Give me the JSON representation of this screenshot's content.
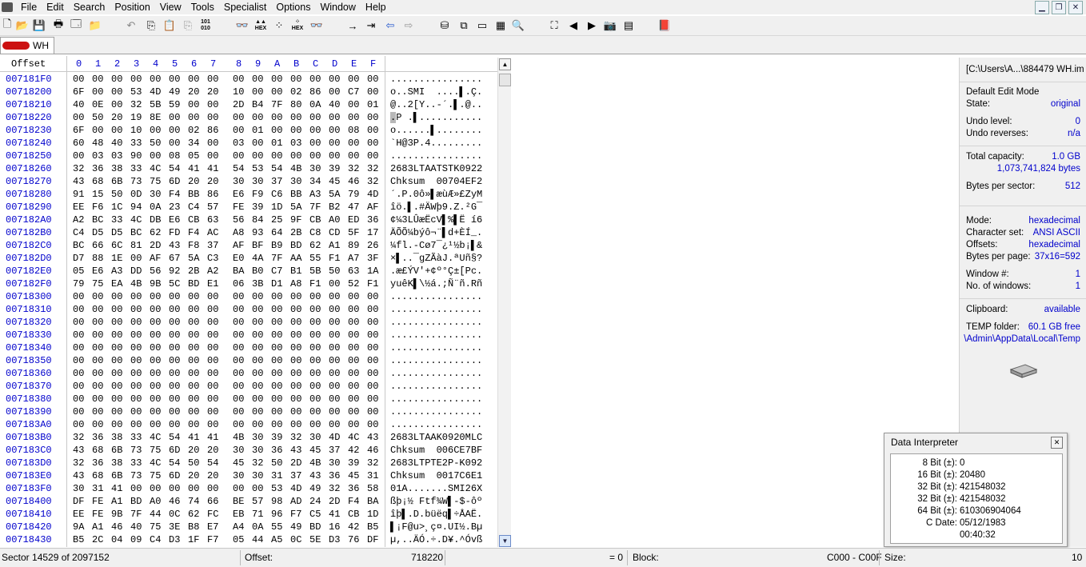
{
  "menu": [
    "File",
    "Edit",
    "Search",
    "Position",
    "View",
    "Tools",
    "Specialist",
    "Options",
    "Window",
    "Help"
  ],
  "tab": {
    "label": "WH"
  },
  "header": {
    "offset_label": "Offset",
    "cols": [
      "0",
      "1",
      "2",
      "3",
      "4",
      "5",
      "6",
      "7",
      "8",
      "9",
      "A",
      "B",
      "C",
      "D",
      "E",
      "F"
    ]
  },
  "rows": [
    {
      "offset": "007181F0",
      "bytes": [
        "00",
        "00",
        "00",
        "00",
        "00",
        "00",
        "00",
        "00",
        "00",
        "00",
        "00",
        "00",
        "00",
        "00",
        "00",
        "00"
      ],
      "ascii": "................"
    },
    {
      "offset": "00718200",
      "bytes": [
        "6F",
        "00",
        "00",
        "53",
        "4D",
        "49",
        "20",
        "20",
        "10",
        "00",
        "00",
        "02",
        "86",
        "00",
        "C7",
        "00"
      ],
      "ascii": "o..SMI  ....▌.Ç."
    },
    {
      "offset": "00718210",
      "bytes": [
        "40",
        "0E",
        "00",
        "32",
        "5B",
        "59",
        "00",
        "00",
        "2D",
        "B4",
        "7F",
        "80",
        "0A",
        "40",
        "00",
        "01"
      ],
      "ascii": "@..2[Y..-´.▌.@.."
    },
    {
      "offset": "00718220",
      "bytes": [
        "00",
        "50",
        "20",
        "19",
        "8E",
        "00",
        "00",
        "00",
        "00",
        "00",
        "00",
        "00",
        "00",
        "00",
        "00",
        "00"
      ],
      "ascii": ".P .▌..........."
    },
    {
      "offset": "00718230",
      "bytes": [
        "6F",
        "00",
        "00",
        "10",
        "00",
        "00",
        "02",
        "86",
        "00",
        "01",
        "00",
        "00",
        "00",
        "00",
        "08",
        "00"
      ],
      "ascii": "o......▌........"
    },
    {
      "offset": "00718240",
      "bytes": [
        "60",
        "48",
        "40",
        "33",
        "50",
        "00",
        "34",
        "00",
        "03",
        "00",
        "01",
        "03",
        "00",
        "00",
        "00",
        "00"
      ],
      "ascii": "`H@3P.4........."
    },
    {
      "offset": "00718250",
      "bytes": [
        "00",
        "03",
        "03",
        "90",
        "00",
        "08",
        "05",
        "00",
        "00",
        "00",
        "00",
        "00",
        "00",
        "00",
        "00",
        "00"
      ],
      "ascii": "................"
    },
    {
      "offset": "00718260",
      "bytes": [
        "32",
        "36",
        "38",
        "33",
        "4C",
        "54",
        "41",
        "41",
        "54",
        "53",
        "54",
        "4B",
        "30",
        "39",
        "32",
        "32"
      ],
      "ascii": "2683LTAATSTK0922"
    },
    {
      "offset": "00718270",
      "bytes": [
        "43",
        "68",
        "6B",
        "73",
        "75",
        "6D",
        "20",
        "20",
        "30",
        "30",
        "37",
        "30",
        "34",
        "45",
        "46",
        "32"
      ],
      "ascii": "Chksum  00704EF2"
    },
    {
      "offset": "00718280",
      "bytes": [
        "91",
        "15",
        "50",
        "0D",
        "30",
        "F4",
        "BB",
        "86",
        "E6",
        "F9",
        "C6",
        "BB",
        "A3",
        "5A",
        "79",
        "4D"
      ],
      "ascii": "´.P.0ô»▌æùÆ»£ZyM"
    },
    {
      "offset": "00718290",
      "bytes": [
        "EE",
        "F6",
        "1C",
        "94",
        "0A",
        "23",
        "C4",
        "57",
        "FE",
        "39",
        "1D",
        "5A",
        "7F",
        "B2",
        "47",
        "AF"
      ],
      "ascii": "îö.▌.#ÄWþ9.Z.²G¯"
    },
    {
      "offset": "007182A0",
      "bytes": [
        "A2",
        "BC",
        "33",
        "4C",
        "DB",
        "E6",
        "CB",
        "63",
        "56",
        "84",
        "25",
        "9F",
        "CB",
        "A0",
        "ED",
        "36"
      ],
      "ascii": "¢¼3LÛæËcV▌%▌Ë í6"
    },
    {
      "offset": "007182B0",
      "bytes": [
        "C4",
        "D5",
        "D5",
        "BC",
        "62",
        "FD",
        "F4",
        "AC",
        "A8",
        "93",
        "64",
        "2B",
        "C8",
        "CD",
        "5F",
        "17"
      ],
      "ascii": "ÄÕÕ¼býô¬¨▌d+ÈÍ_."
    },
    {
      "offset": "007182C0",
      "bytes": [
        "BC",
        "66",
        "6C",
        "81",
        "2D",
        "43",
        "F8",
        "37",
        "AF",
        "BF",
        "B9",
        "BD",
        "62",
        "A1",
        "89",
        "26"
      ],
      "ascii": "¼fl.-Cø7¯¿¹½b¡▌&"
    },
    {
      "offset": "007182D0",
      "bytes": [
        "D7",
        "88",
        "1E",
        "00",
        "AF",
        "67",
        "5A",
        "C3",
        "E0",
        "4A",
        "7F",
        "AA",
        "55",
        "F1",
        "A7",
        "3F"
      ],
      "ascii": "×▌..¯gZÃàJ.ªUñ§?"
    },
    {
      "offset": "007182E0",
      "bytes": [
        "05",
        "E6",
        "A3",
        "DD",
        "56",
        "92",
        "2B",
        "A2",
        "BA",
        "B0",
        "C7",
        "B1",
        "5B",
        "50",
        "63",
        "1A"
      ],
      "ascii": ".æ£ÝV'+¢º°Ç±[Pc."
    },
    {
      "offset": "007182F0",
      "bytes": [
        "79",
        "75",
        "EA",
        "4B",
        "9B",
        "5C",
        "BD",
        "E1",
        "06",
        "3B",
        "D1",
        "A8",
        "F1",
        "00",
        "52",
        "F1"
      ],
      "ascii": "yuêK▌\\½á.;Ñ¨ñ.Rñ"
    },
    {
      "offset": "00718300",
      "bytes": [
        "00",
        "00",
        "00",
        "00",
        "00",
        "00",
        "00",
        "00",
        "00",
        "00",
        "00",
        "00",
        "00",
        "00",
        "00",
        "00"
      ],
      "ascii": "................"
    },
    {
      "offset": "00718310",
      "bytes": [
        "00",
        "00",
        "00",
        "00",
        "00",
        "00",
        "00",
        "00",
        "00",
        "00",
        "00",
        "00",
        "00",
        "00",
        "00",
        "00"
      ],
      "ascii": "................"
    },
    {
      "offset": "00718320",
      "bytes": [
        "00",
        "00",
        "00",
        "00",
        "00",
        "00",
        "00",
        "00",
        "00",
        "00",
        "00",
        "00",
        "00",
        "00",
        "00",
        "00"
      ],
      "ascii": "................"
    },
    {
      "offset": "00718330",
      "bytes": [
        "00",
        "00",
        "00",
        "00",
        "00",
        "00",
        "00",
        "00",
        "00",
        "00",
        "00",
        "00",
        "00",
        "00",
        "00",
        "00"
      ],
      "ascii": "................"
    },
    {
      "offset": "00718340",
      "bytes": [
        "00",
        "00",
        "00",
        "00",
        "00",
        "00",
        "00",
        "00",
        "00",
        "00",
        "00",
        "00",
        "00",
        "00",
        "00",
        "00"
      ],
      "ascii": "................"
    },
    {
      "offset": "00718350",
      "bytes": [
        "00",
        "00",
        "00",
        "00",
        "00",
        "00",
        "00",
        "00",
        "00",
        "00",
        "00",
        "00",
        "00",
        "00",
        "00",
        "00"
      ],
      "ascii": "................"
    },
    {
      "offset": "00718360",
      "bytes": [
        "00",
        "00",
        "00",
        "00",
        "00",
        "00",
        "00",
        "00",
        "00",
        "00",
        "00",
        "00",
        "00",
        "00",
        "00",
        "00"
      ],
      "ascii": "................"
    },
    {
      "offset": "00718370",
      "bytes": [
        "00",
        "00",
        "00",
        "00",
        "00",
        "00",
        "00",
        "00",
        "00",
        "00",
        "00",
        "00",
        "00",
        "00",
        "00",
        "00"
      ],
      "ascii": "................"
    },
    {
      "offset": "00718380",
      "bytes": [
        "00",
        "00",
        "00",
        "00",
        "00",
        "00",
        "00",
        "00",
        "00",
        "00",
        "00",
        "00",
        "00",
        "00",
        "00",
        "00"
      ],
      "ascii": "................"
    },
    {
      "offset": "00718390",
      "bytes": [
        "00",
        "00",
        "00",
        "00",
        "00",
        "00",
        "00",
        "00",
        "00",
        "00",
        "00",
        "00",
        "00",
        "00",
        "00",
        "00"
      ],
      "ascii": "................"
    },
    {
      "offset": "007183A0",
      "bytes": [
        "00",
        "00",
        "00",
        "00",
        "00",
        "00",
        "00",
        "00",
        "00",
        "00",
        "00",
        "00",
        "00",
        "00",
        "00",
        "00"
      ],
      "ascii": "................"
    },
    {
      "offset": "007183B0",
      "bytes": [
        "32",
        "36",
        "38",
        "33",
        "4C",
        "54",
        "41",
        "41",
        "4B",
        "30",
        "39",
        "32",
        "30",
        "4D",
        "4C",
        "43"
      ],
      "ascii": "2683LTAAK0920MLC"
    },
    {
      "offset": "007183C0",
      "bytes": [
        "43",
        "68",
        "6B",
        "73",
        "75",
        "6D",
        "20",
        "20",
        "30",
        "30",
        "36",
        "43",
        "45",
        "37",
        "42",
        "46"
      ],
      "ascii": "Chksum  006CE7BF"
    },
    {
      "offset": "007183D0",
      "bytes": [
        "32",
        "36",
        "38",
        "33",
        "4C",
        "54",
        "50",
        "54",
        "45",
        "32",
        "50",
        "2D",
        "4B",
        "30",
        "39",
        "32"
      ],
      "ascii": "2683LTPTE2P-K092"
    },
    {
      "offset": "007183E0",
      "bytes": [
        "43",
        "68",
        "6B",
        "73",
        "75",
        "6D",
        "20",
        "20",
        "30",
        "30",
        "31",
        "37",
        "43",
        "36",
        "45",
        "31"
      ],
      "ascii": "Chksum  0017C6E1"
    },
    {
      "offset": "007183F0",
      "bytes": [
        "30",
        "31",
        "41",
        "00",
        "00",
        "00",
        "00",
        "00",
        "00",
        "00",
        "53",
        "4D",
        "49",
        "32",
        "36",
        "58"
      ],
      "ascii": "01A.......SMI26X"
    },
    {
      "offset": "00718400",
      "bytes": [
        "DF",
        "FE",
        "A1",
        "BD",
        "A0",
        "46",
        "74",
        "66",
        "BE",
        "57",
        "98",
        "AD",
        "24",
        "2D",
        "F4",
        "BA"
      ],
      "ascii": "ßþ¡½ Ftf¾W▌-$-ôº"
    },
    {
      "offset": "00718410",
      "bytes": [
        "EE",
        "FE",
        "9B",
        "7F",
        "44",
        "0C",
        "62",
        "FC",
        "EB",
        "71",
        "96",
        "F7",
        "C5",
        "41",
        "CB",
        "1D"
      ],
      "ascii": "îþ▌.D.büëq▌÷ÅAË."
    },
    {
      "offset": "00718420",
      "bytes": [
        "9A",
        "A1",
        "46",
        "40",
        "75",
        "3E",
        "B8",
        "E7",
        "A4",
        "0A",
        "55",
        "49",
        "BD",
        "16",
        "42",
        "B5"
      ],
      "ascii": "▌¡F@u>¸ç¤.UI½.Bµ"
    },
    {
      "offset": "00718430",
      "bytes": [
        "B5",
        "2C",
        "04",
        "09",
        "C4",
        "D3",
        "1F",
        "F7",
        "05",
        "44",
        "A5",
        "0C",
        "5E",
        "D3",
        "76",
        "DF"
      ],
      "ascii": "µ,..ÄÓ.÷.D¥.^Óvß"
    }
  ],
  "panel": {
    "path": "[C:\\Users\\A...\\884479 WH.im",
    "edit_mode": "Default Edit Mode",
    "state_label": "State:",
    "state_value": "original",
    "undo_level_label": "Undo level:",
    "undo_level_value": "0",
    "undo_reverses_label": "Undo reverses:",
    "undo_reverses_value": "n/a",
    "total_capacity_label": "Total capacity:",
    "total_capacity_value": "1.0 GB",
    "total_bytes": "1,073,741,824 bytes",
    "bytes_per_sector_label": "Bytes per sector:",
    "bytes_per_sector_value": "512",
    "mode_label": "Mode:",
    "mode_value": "hexadecimal",
    "charset_label": "Character set:",
    "charset_value": "ANSI ASCII",
    "offsets_label": "Offsets:",
    "offsets_value": "hexadecimal",
    "bpp_label": "Bytes per page:",
    "bpp_value": "37x16=592",
    "window_label": "Window #:",
    "window_value": "1",
    "nwindows_label": "No. of windows:",
    "nwindows_value": "1",
    "clipboard_label": "Clipboard:",
    "clipboard_value": "available",
    "temp_label": "TEMP folder:",
    "temp_value": "60.1 GB free",
    "temp_path": "\\Admin\\AppData\\Local\\Temp"
  },
  "data_interpreter": {
    "title": "Data Interpreter",
    "lines": [
      {
        "k": "8 Bit (±):",
        "v": "0"
      },
      {
        "k": "16 Bit (±):",
        "v": "20480"
      },
      {
        "k": "32 Bit (±):",
        "v": "421548032"
      },
      {
        "k": "32 Bit (±):",
        "v": "421548032"
      },
      {
        "k": "64 Bit (±):",
        "v": "610306904064"
      },
      {
        "k": "C Date:",
        "v": "05/12/1983"
      },
      {
        "k": "",
        "v": "00:40:32"
      }
    ]
  },
  "status": {
    "sector": "Sector 14529 of 2097152",
    "offset_label": "Offset:",
    "offset_value": "718220",
    "eq_value": "= 0",
    "block_label": "Block:",
    "block_value": "C000 - C00F",
    "size_label": "Size:",
    "size_value": "10"
  }
}
